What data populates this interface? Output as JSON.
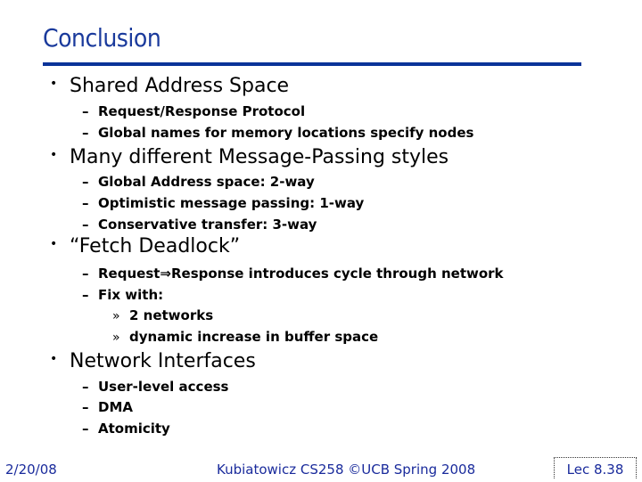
{
  "slide": {
    "title": "Conclusion",
    "bullets": [
      {
        "text": "Shared Address Space",
        "sub": [
          {
            "text": "Request/Response Protocol"
          },
          {
            "text": "Global names for memory locations specify nodes"
          }
        ]
      },
      {
        "text": "Many different Message-Passing styles",
        "sub": [
          {
            "text": "Global Address space: 2-way"
          },
          {
            "text": "Optimistic message passing: 1-way"
          },
          {
            "text": "Conservative transfer: 3-way"
          }
        ]
      },
      {
        "text": "“Fetch Deadlock”",
        "sub": [
          {
            "text": "Request⇒Response introduces cycle through network"
          },
          {
            "text": "Fix with:",
            "sub": [
              {
                "text": "2 networks"
              },
              {
                "text": "dynamic increase in buffer space"
              }
            ]
          }
        ]
      },
      {
        "text": "Network Interfaces",
        "sub": [
          {
            "text": "User-level access"
          },
          {
            "text": "DMA"
          },
          {
            "text": "Atomicity"
          }
        ]
      }
    ],
    "markers": {
      "bullet": "•",
      "dash": "–",
      "sub": "»"
    }
  },
  "footer": {
    "date": "2/20/08",
    "center": "Kubiatowicz CS258 ©UCB Spring 2008",
    "page": "Lec 8.38"
  },
  "colors": {
    "title": "#1a3a9c",
    "rule": "#0a3399",
    "footer": "#1a2b9c",
    "text": "#000000"
  }
}
